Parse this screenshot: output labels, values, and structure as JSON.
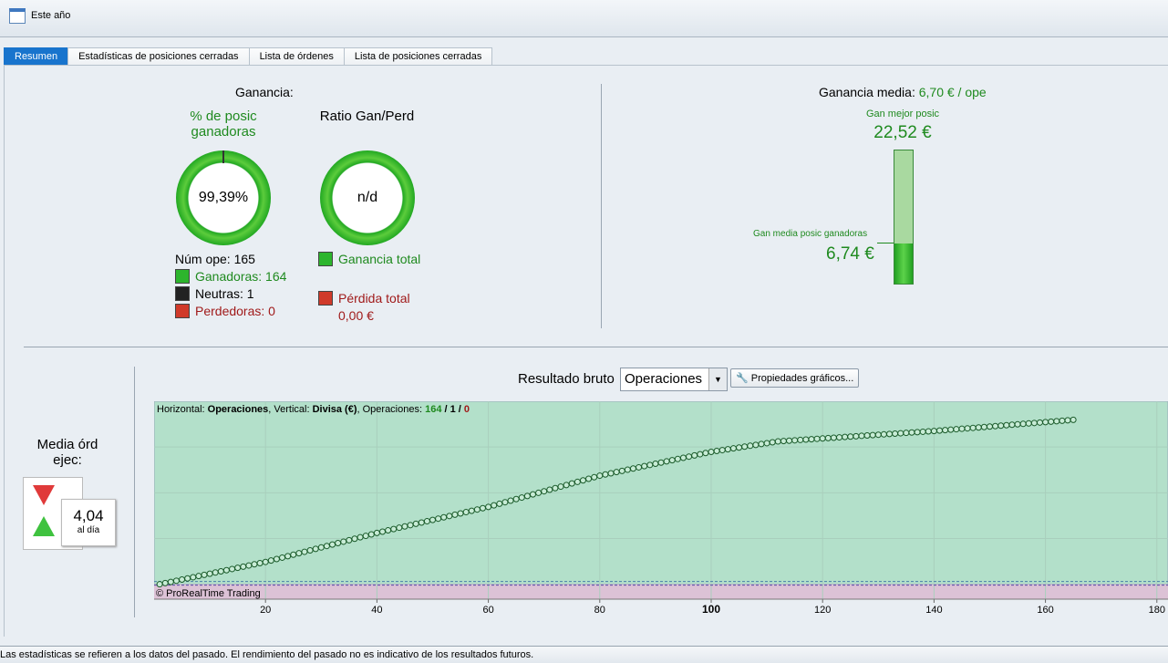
{
  "toolbar": {
    "period_label": "Este año"
  },
  "tabs": [
    {
      "label": "Resumen",
      "active": true
    },
    {
      "label": "Estadísticas de posiciones cerradas"
    },
    {
      "label": "Lista de órdenes"
    },
    {
      "label": "Lista de posiciones cerradas"
    }
  ],
  "summary": {
    "gain_label": "Ganancia:",
    "win_pct_title": "% de posic ganadoras",
    "win_pct_value": "99,39%",
    "ratio_title": "Ratio Gan/Perd",
    "ratio_value": "n/d",
    "num_ops": "Núm ope: 165",
    "winners": "Ganadoras: 164",
    "neutral": "Neutras: 1",
    "losers": "Perdedoras: 0",
    "total_gain_label": "Ganancia total",
    "total_loss_label": "Pérdida total",
    "total_loss_value": "0,00 €"
  },
  "average": {
    "label": "Ganancia media:",
    "value": "6,70 € / ope",
    "best_label": "Gan mejor posic",
    "best_value": "22,52 €",
    "avg_win_label": "Gan media posic ganadoras",
    "avg_win_value": "6,74 €",
    "avg_win_fraction": 0.3
  },
  "orders": {
    "title": "Media órd ejec:",
    "value": "4,04",
    "unit": "al día"
  },
  "chart_controls": {
    "title": "Resultado bruto",
    "select_value": "Operaciones",
    "props_button": "Propiedades gráficos..."
  },
  "chart_data": {
    "type": "scatter",
    "info_prefix": "Horizontal: ",
    "info_h": "Operaciones",
    "info_mid": ", Vertical: ",
    "info_v": "Divisa (€)",
    "info_ops": ", Operaciones: ",
    "count_win": "164",
    "count_neutral": "1",
    "count_loss": "0",
    "copyright": "© ProRealTime Trading",
    "xlim": [
      0,
      182
    ],
    "ylim": [
      -100,
      1230
    ],
    "xticks": [
      "20",
      "40",
      "60",
      "80",
      "100",
      "120",
      "140",
      "160",
      "180"
    ],
    "anchors_x": [
      1,
      20,
      40,
      60,
      80,
      100,
      112,
      120,
      140,
      165
    ],
    "anchors_y": [
      0,
      150,
      345,
      520,
      730,
      890,
      960,
      980,
      1030,
      1105
    ],
    "n_points": 165
  },
  "status": {
    "text": "Las estadísticas se refieren a los datos del pasado. El rendimiento del pasado no es indicativo de los resultados futuros."
  }
}
